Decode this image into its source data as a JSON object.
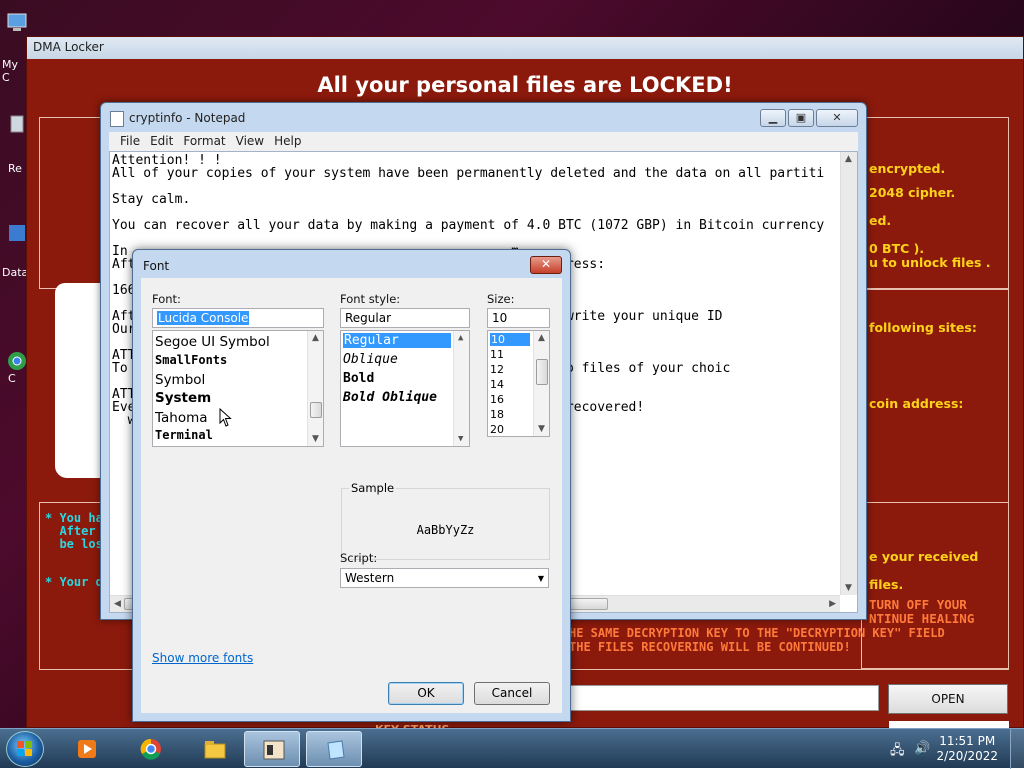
{
  "desktop": {
    "icons": [
      {
        "label": "My C",
        "icon": "computer-icon"
      },
      {
        "label": "Re",
        "icon": "recycle-bin-icon"
      },
      {
        "label": "Data",
        "icon": "data-icon"
      },
      {
        "label": "C",
        "icon": "chrome-icon"
      }
    ]
  },
  "dma": {
    "title": "DMA Locker",
    "headline": "All your personal files are LOCKED!",
    "right_texts": [
      "encrypted.",
      "2048 cipher.",
      "ed.",
      "0 BTC ).",
      "u to unlock files .",
      "following sites:",
      "coin address:",
      "e your received",
      "files."
    ],
    "warning_lines": [
      "TURN OFF YOUR",
      "NTINUE HEALING",
      "HE SAME DECRYPTION KEY TO THE \"DECRYPTION  KEY\" FIELD",
      " THE FILES RECOVERING WILL BE CONTINUED!"
    ],
    "left_notes": [
      "* You ha",
      "  After t",
      "  be lost",
      "* Your d"
    ],
    "key_status": "KEY STATUS",
    "open_button": "OPEN",
    "colors": {
      "background": "#8b1a0c",
      "yellow": "#ffd21a",
      "orange": "#ff7a3a",
      "cyan": "#29d7e0"
    }
  },
  "notepad": {
    "title": "cryptinfo - Notepad",
    "menu": [
      "File",
      "Edit",
      "Format",
      "View",
      "Help"
    ],
    "lines": [
      "Attention! ! !",
      "All of your copies of your system have been permanently deleted and the data on all partiti",
      "",
      "Stay calm.",
      "",
      "You can recover all your data by making a payment of 4.0 BTC (1072 GBP) in Bitcoin currency",
      "",
      "In                                                 m",
      "Aft                                          to our BTC adress:",
      "",
      "166",
      "",
      "Aft                                          n mail title write your unique ID",
      "Our",
      "",
      "ATT",
      "To                                           to decrypt two files of your choic",
      "",
      "ATT",
      "Eve                                          may be still recovered!",
      "  wh                                         es"
    ]
  },
  "font_dialog": {
    "title": "Font",
    "font_label": "Font:",
    "font_value": "Lucida Console",
    "font_list": [
      "Segoe UI Symbol",
      "SmallFonts",
      "Symbol",
      "System",
      "Tahoma",
      "Terminal"
    ],
    "style_label": "Font style:",
    "style_value": "Regular",
    "style_list": [
      "Regular",
      "Oblique",
      "Bold",
      "Bold Oblique"
    ],
    "size_label": "Size:",
    "size_value": "10",
    "size_list": [
      "10",
      "11",
      "12",
      "14",
      "16",
      "18",
      "20"
    ],
    "sample_label": "Sample",
    "sample_text": "AaBbYyZz",
    "script_label": "Script:",
    "script_value": "Western",
    "show_more": "Show more fonts",
    "ok": "OK",
    "cancel": "Cancel"
  },
  "taskbar": {
    "time": "11:51 PM",
    "date": "2/20/2022",
    "apps": [
      "media-player-icon",
      "chrome-icon",
      "explorer-icon",
      "dma-locker-icon",
      "notepad-icon"
    ]
  }
}
